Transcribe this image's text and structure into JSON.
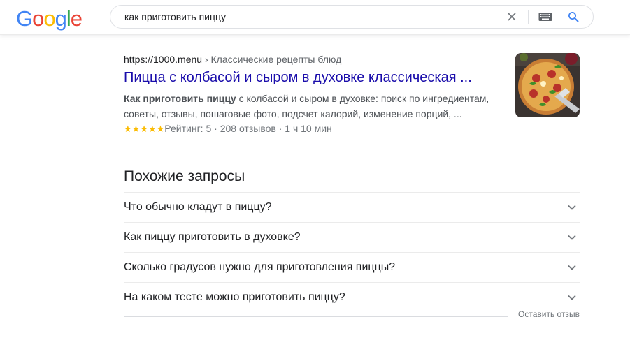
{
  "header": {
    "logo_letters": [
      {
        "ch": "G",
        "color": "#4285F4"
      },
      {
        "ch": "o",
        "color": "#EA4335"
      },
      {
        "ch": "o",
        "color": "#FBBC05"
      },
      {
        "ch": "g",
        "color": "#4285F4"
      },
      {
        "ch": "l",
        "color": "#34A853"
      },
      {
        "ch": "e",
        "color": "#EA4335"
      }
    ],
    "search": {
      "value": "как приготовить пиццу",
      "icons": [
        "close-icon",
        "keyboard-icon",
        "search-icon"
      ],
      "accent": "#4285F4"
    }
  },
  "result": {
    "url": "https://1000.menu",
    "breadcrumb": "› Классические рецепты блюд",
    "title": "Пицца с колбасой и сыром в духовке классическая ...",
    "snippet_bold": "Как приготовить пиццу",
    "snippet_rest": " с колбасой и сыром в духовке: поиск по ингредиентам, советы, отзывы, пошаговые фото, подсчет калорий, изменение порций, ...",
    "stars": "★★★★★",
    "rating": "Рейтинг: 5",
    "reviews": "208 отзывов",
    "time": "1 ч 10 мин",
    "separator": "·",
    "title_color": "#1a0dab",
    "star_color": "#fbbc04"
  },
  "related": {
    "heading": "Похожие запросы",
    "items": [
      "Что обычно кладут в пиццу?",
      "Как пиццу приготовить в духовке?",
      "Сколько градусов нужно для приготовления пиццы?",
      "На каком тесте можно приготовить пиццу?"
    ],
    "feedback": "Оставить отзыв"
  }
}
